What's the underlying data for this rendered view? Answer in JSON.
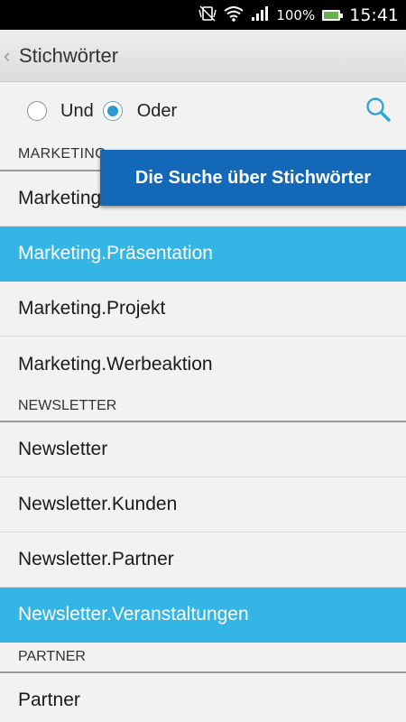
{
  "status_bar": {
    "battery_pct": "100%",
    "time": "15:41"
  },
  "action_bar": {
    "back_icon": "chevron-left-icon",
    "title": "Stichwörter"
  },
  "filter": {
    "and_label": "Und",
    "or_label": "Oder",
    "selected": "Oder"
  },
  "tooltip": "Die Suche über Stichwörter",
  "sections": [
    {
      "header": "MARKETING",
      "items": [
        "Marketing",
        "Marketing.Präsentation",
        "Marketing.Projekt",
        "Marketing.Werbeaktion"
      ]
    },
    {
      "header": "NEWSLETTER",
      "items": [
        "Newsletter",
        "Newsletter.Kunden",
        "Newsletter.Partner",
        "Newsletter.Veranstaltungen"
      ]
    },
    {
      "header": "PARTNER",
      "items": [
        "Partner"
      ]
    }
  ],
  "colors": {
    "selected_row": "#33b5e5",
    "tooltip_bg": "#1468b8",
    "radio_accent": "#2d9ad3"
  }
}
